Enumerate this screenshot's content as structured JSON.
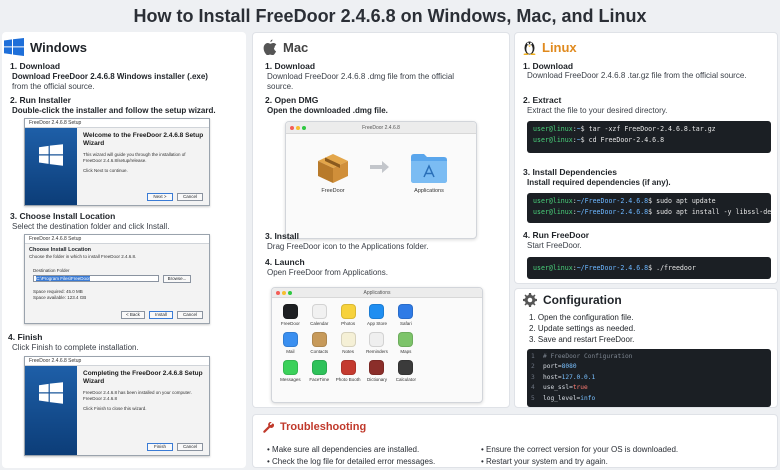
{
  "page_title": "How to Install FreeDoor 2.4.6.8 on Windows, Mac, and Linux",
  "windows": {
    "heading": "Windows",
    "steps": [
      {
        "title": "1. Download",
        "desc": "Download FreeDoor 2.4.6.8 Windows installer (.exe)",
        "desc2": "from the official source."
      },
      {
        "title": "2. Run Installer",
        "desc": "Double-click the installer and follow the setup wizard."
      },
      {
        "title": "3. Choose Install Location",
        "desc": "Select the destination folder and click Install."
      },
      {
        "title": "4. Finish",
        "desc": "Click Finish to complete installation."
      }
    ],
    "wizard1": {
      "titlebar": "FreeDoor 2.4.6.8 Setup",
      "heading": "Welcome to the FreeDoor 2.4.6.8 Setup Wizard",
      "text": "This wizard will guide you through the installation of FreeDoor 2.4.6.8/setup/release.",
      "text2": "Click Next to continue.",
      "next": "Next >",
      "cancel": "Cancel"
    },
    "wizard2": {
      "titlebar": "FreeDoor 2.4.6.8 Setup",
      "heading": "Choose Install Location",
      "text": "Choose the folder in which to install FreeDoor 2.4.6.8.",
      "folder_label": "Destination Folder",
      "folder_value": "C:\\Program Files\\FreeDoor",
      "browse": "Browse...",
      "space_req": "Space required: 45.0 MB",
      "space_avail": "Space available: 123.4 GB",
      "back": "< Back",
      "install": "Install",
      "cancel": "Cancel"
    },
    "wizard3": {
      "titlebar": "FreeDoor 2.4.6.8 Setup",
      "heading": "Completing the FreeDoor 2.4.6.8 Setup Wizard",
      "text": "FreeDoor 2.4.6.8 has been installed on your computer. FreeDoor 2.4.6.8",
      "text2": "Click Finish to close this wizard.",
      "finish": "Finish",
      "cancel": "Cancel"
    }
  },
  "mac": {
    "heading": "Mac",
    "steps": [
      {
        "title": "1. Download",
        "desc": "Download FreeDoor 2.4.6.8 .dmg file from the official",
        "desc2": "source."
      },
      {
        "title": "2. Open DMG",
        "desc": "Open the downloaded .dmg file."
      },
      {
        "title": "3. Install",
        "desc": "Drag FreeDoor icon to the Applications folder."
      },
      {
        "title": "4. Launch",
        "desc": "Open FreeDoor from Applications."
      }
    ],
    "dmg_window_title": "FreeDoor 2.4.6.8",
    "dmg_app_label": "FreeDoor",
    "dmg_folder_label": "Applications",
    "apps_window_title": "Applications",
    "apps": [
      {
        "label": "FreeDoor",
        "color": "#1d1f22"
      },
      {
        "label": "Calendar",
        "color": "#f1f1f1"
      },
      {
        "label": "Photos",
        "color": "#f7d23c"
      },
      {
        "label": "App Store",
        "color": "#1f8ef1"
      },
      {
        "label": "Safari",
        "color": "#2f7be6"
      },
      {
        "label": "",
        "color": "transparent"
      },
      {
        "label": "",
        "color": "transparent"
      },
      {
        "label": "Mail",
        "color": "#3a8ff0"
      },
      {
        "label": "Contacts",
        "color": "#c79a5a"
      },
      {
        "label": "Notes",
        "color": "#f5f0d6"
      },
      {
        "label": "Reminders",
        "color": "#efefef"
      },
      {
        "label": "Maps",
        "color": "#7dc46a"
      },
      {
        "label": "",
        "color": "transparent"
      },
      {
        "label": "",
        "color": "transparent"
      },
      {
        "label": "Messages",
        "color": "#3bd15a"
      },
      {
        "label": "FaceTime",
        "color": "#2ec25a"
      },
      {
        "label": "Photo Booth",
        "color": "#c43a2f"
      },
      {
        "label": "Dictionary",
        "color": "#8b2e2a"
      },
      {
        "label": "Calculator",
        "color": "#3b3b3b"
      },
      {
        "label": "",
        "color": "transparent"
      },
      {
        "label": "",
        "color": "transparent"
      }
    ]
  },
  "linux": {
    "heading": "Linux",
    "steps": [
      {
        "title": "1. Download",
        "desc": "Download FreeDoor 2.4.6.8 .tar.gz file from the official source."
      },
      {
        "title": "2. Extract",
        "desc": "Extract the file to your desired directory."
      },
      {
        "title": "3. Install Dependencies",
        "desc": "Install required dependencies (if any)."
      },
      {
        "title": "4. Run FreeDoor",
        "desc": "Start FreeDoor."
      }
    ],
    "term1": [
      {
        "user": "user@linux",
        "path": "~",
        "cmd": "$ tar -xzf FreeDoor-2.4.6.8.tar.gz"
      },
      {
        "user": "user@linux",
        "path": "~",
        "cmd": "$ cd FreeDoor-2.4.6.8"
      }
    ],
    "term2": [
      {
        "user": "user@linux",
        "path": "~/FreeDoor-2.4.6.8",
        "cmd": "$ sudo apt update"
      },
      {
        "user": "user@linux",
        "path": "~/FreeDoor-2.4.6.8",
        "cmd": "$ sudo apt install -y libssl-dev"
      }
    ],
    "term3": [
      {
        "user": "user@linux",
        "path": "~/FreeDoor-2.4.6.8",
        "cmd": "$ ./freedoor"
      }
    ]
  },
  "configuration": {
    "heading": "Configuration",
    "steps": [
      "1. Open the configuration file.",
      "2. Update settings as needed.",
      "3. Save and restart FreeDoor."
    ],
    "code": [
      {
        "n": "1",
        "text": "# FreeDoor Configuration"
      },
      {
        "n": "2",
        "key": "port=",
        "val": "8080"
      },
      {
        "n": "3",
        "key": "host=",
        "val": "127.0.0.1"
      },
      {
        "n": "4",
        "key": "use_ssl=",
        "val": "true"
      },
      {
        "n": "5",
        "key": "log_level=",
        "val": "info"
      }
    ]
  },
  "troubleshooting": {
    "heading": "Troubleshooting",
    "tips": [
      "• Make sure all dependencies are installed.",
      "• Check the log file for detailed error messages.",
      "• Ensure the correct version for your OS is downloaded.",
      "• Restart your system and try again."
    ]
  },
  "colors": {
    "windows_blue": "#1e6fd9",
    "linux_orange": "#e08a1e",
    "trouble_red": "#c0392b",
    "terminal_bg": "#1b1f24"
  }
}
